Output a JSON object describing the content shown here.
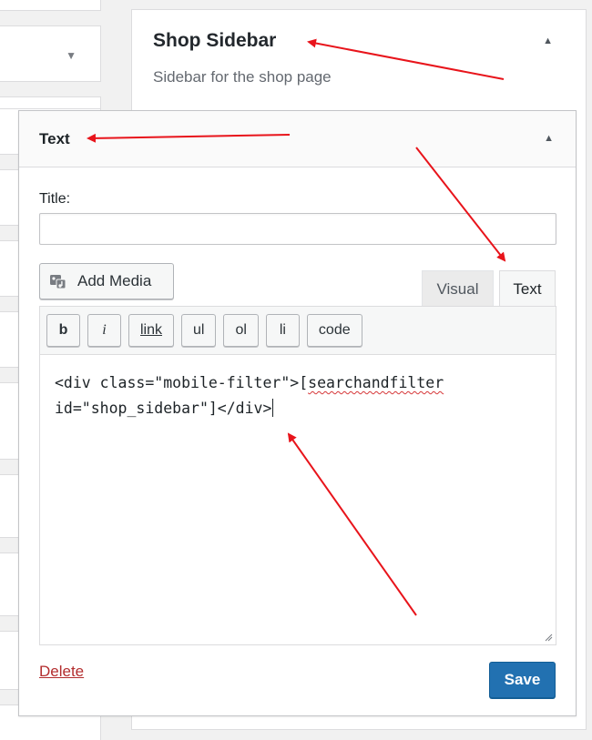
{
  "shop_sidebar": {
    "title": "Shop Sidebar",
    "description": "Sidebar for the shop page",
    "toggle_icon": "triangle-up-icon"
  },
  "widget": {
    "title": "Text",
    "toggle_icon": "triangle-up-icon",
    "title_label": "Title:",
    "title_value": "",
    "add_media_label": "Add Media",
    "tabs": [
      {
        "label": "Visual",
        "active": false
      },
      {
        "label": "Text",
        "active": true
      }
    ],
    "quicktags": [
      "b",
      "i",
      "link",
      "ul",
      "ol",
      "li",
      "code"
    ],
    "content_line1_prefix": "<div class=\"mobile-filter\">[",
    "content_line1_spell": "searchandfilter",
    "content_line2": "id=\"shop_sidebar\"]</div>",
    "delete_label": "Delete",
    "save_label": "Save"
  },
  "colors": {
    "primary_button": "#2271b1",
    "delete_link": "#b32d2e",
    "annotation_arrow": "#e8141b"
  }
}
